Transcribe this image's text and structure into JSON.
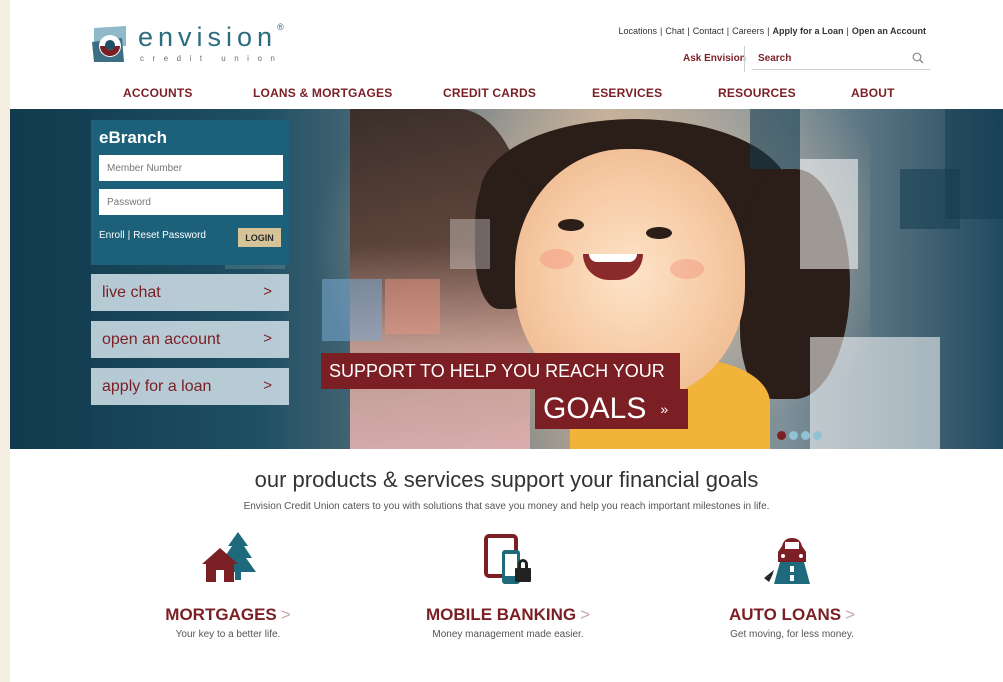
{
  "brand": {
    "name": "envision",
    "registered": "®",
    "sub": "credit union",
    "primary_color": "#7b1f24",
    "teal_color": "#2b6d7f"
  },
  "utility_links": [
    {
      "label": "Locations",
      "bold": false
    },
    {
      "label": "Chat",
      "bold": false
    },
    {
      "label": "Contact",
      "bold": false
    },
    {
      "label": "Careers",
      "bold": false
    },
    {
      "label": "Apply for a Loan",
      "bold": true
    },
    {
      "label": "Open an Account",
      "bold": true
    }
  ],
  "header": {
    "ask_label": "Ask Envision",
    "search_placeholder": "Search",
    "search_icon": "search-icon"
  },
  "nav": [
    "ACCOUNTS",
    "LOANS & MORTGAGES",
    "CREDIT CARDS",
    "ESERVICES",
    "RESOURCES",
    "ABOUT"
  ],
  "ebranch": {
    "title": "eBranch",
    "member_placeholder": "Member Number",
    "password_placeholder": "Password",
    "enroll": "Enroll",
    "separator": "|",
    "reset": "Reset Password",
    "login": "LOGIN"
  },
  "quick_links": [
    {
      "label": "live chat",
      "chevron": ">"
    },
    {
      "label": "open an account",
      "chevron": ">"
    },
    {
      "label": "apply for a loan",
      "chevron": ">"
    }
  ],
  "promo": {
    "line1": "SUPPORT TO HELP YOU REACH YOUR",
    "line2": "GOALS",
    "arrow": "»"
  },
  "slider": {
    "count": 4,
    "active_index": 0
  },
  "section": {
    "headline": "our products & services support your financial goals",
    "subline": "Envision Credit Union caters to you with solutions that save you money and help you reach important milestones in life."
  },
  "products": [
    {
      "title": "MORTGAGES",
      "arrow": ">",
      "desc": "Your key to a better life.",
      "icon": "house-tree-icon"
    },
    {
      "title": "MOBILE BANKING",
      "arrow": ">",
      "desc": "Money management made easier.",
      "icon": "devices-lock-icon"
    },
    {
      "title": "AUTO LOANS",
      "arrow": ">",
      "desc": "Get moving, for less money.",
      "icon": "car-road-icon"
    }
  ]
}
